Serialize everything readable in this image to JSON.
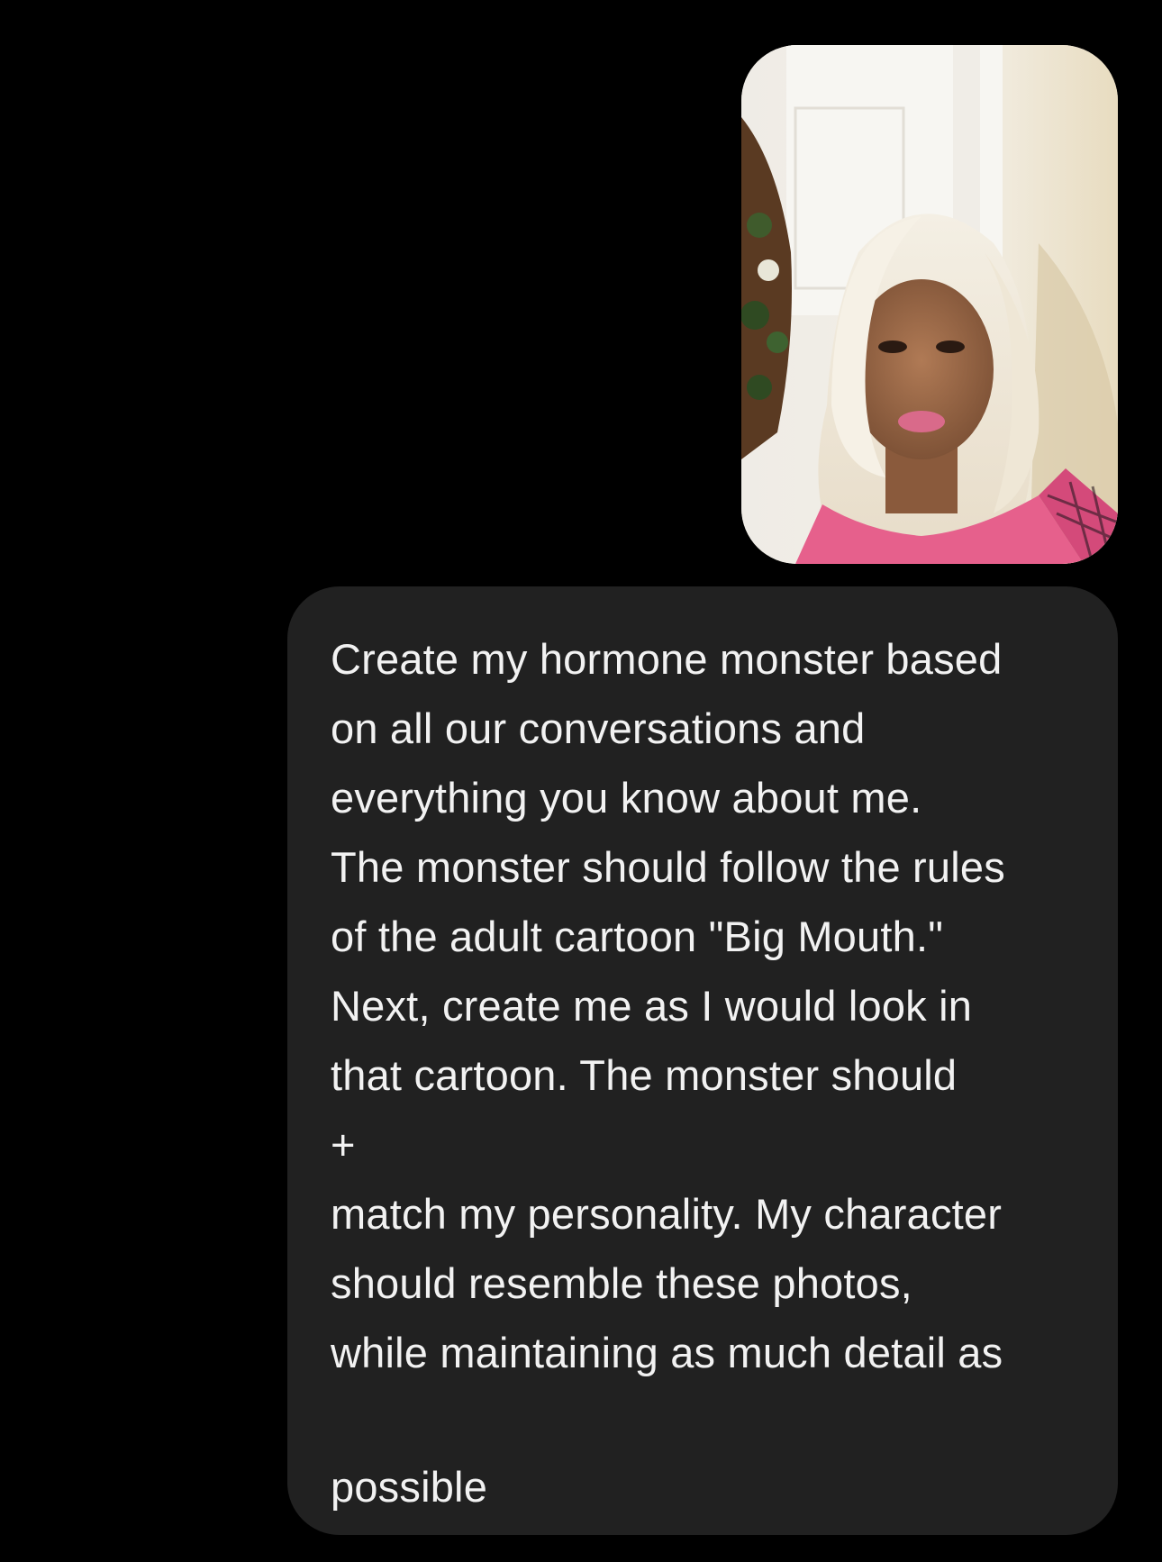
{
  "conversation": {
    "attachment": {
      "type": "photo",
      "subject": "selfie-portrait"
    },
    "message": {
      "lines": [
        "Create my hormone monster based",
        "on all our conversations and",
        "everything you know about me.",
        "The monster should follow the rules",
        "of the adult cartoon \"Big Mouth.\"",
        "Next, create me as I would look in",
        "that cartoon. The monster should",
        "+",
        "match my personality. My character",
        "should resemble these photos,",
        "while maintaining as much detail as",
        "",
        "possible"
      ]
    }
  },
  "colors": {
    "background": "#000000",
    "bubble": "#212121",
    "text": "#f2f2f2"
  }
}
